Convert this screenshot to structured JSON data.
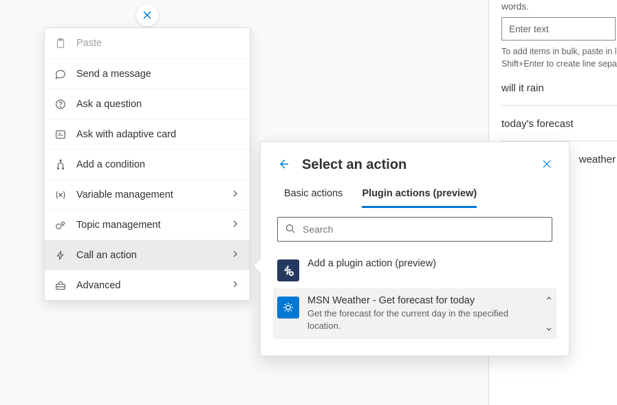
{
  "close_bubble_icon": "close",
  "context_menu": [
    {
      "key": "paste",
      "icon": "clipboard",
      "label": "Paste",
      "disabled": true,
      "chevron": false
    },
    {
      "key": "send-message",
      "icon": "chat",
      "label": "Send a message",
      "disabled": false,
      "chevron": false
    },
    {
      "key": "ask-question",
      "icon": "question",
      "label": "Ask a question",
      "disabled": false,
      "chevron": false
    },
    {
      "key": "ask-adaptive",
      "icon": "card",
      "label": "Ask with adaptive card",
      "disabled": false,
      "chevron": false
    },
    {
      "key": "add-condition",
      "icon": "branch",
      "label": "Add a condition",
      "disabled": false,
      "chevron": false
    },
    {
      "key": "variable-mgmt",
      "icon": "variable",
      "label": "Variable management",
      "disabled": false,
      "chevron": true
    },
    {
      "key": "topic-mgmt",
      "icon": "topic",
      "label": "Topic management",
      "disabled": false,
      "chevron": true
    },
    {
      "key": "call-action",
      "icon": "bolt",
      "label": "Call an action",
      "disabled": false,
      "chevron": true,
      "active": true
    },
    {
      "key": "advanced",
      "icon": "toolbox",
      "label": "Advanced",
      "disabled": false,
      "chevron": true
    }
  ],
  "panel": {
    "title": "Select an action",
    "tabs": {
      "basic": "Basic actions",
      "plugin": "Plugin actions (preview)"
    },
    "search_placeholder": "Search",
    "items": [
      {
        "key": "add-plugin",
        "icon": "plugin-add",
        "title": "Add a plugin action (preview)",
        "desc": "",
        "highlight": false,
        "icon_class": "ai-dark"
      },
      {
        "key": "msn-weather",
        "icon": "weather",
        "title": "MSN Weather - Get forecast for today",
        "desc": "Get the forecast for the current day in the specified location.",
        "highlight": true,
        "icon_class": "ai-blue"
      }
    ]
  },
  "side": {
    "partial_top": "words.",
    "input_placeholder": "Enter text",
    "hint1": "To add items in bulk, paste in li",
    "hint2": "Shift+Enter to create line separ",
    "phrases": [
      "will it rain",
      "today's forecast",
      "weather"
    ]
  }
}
